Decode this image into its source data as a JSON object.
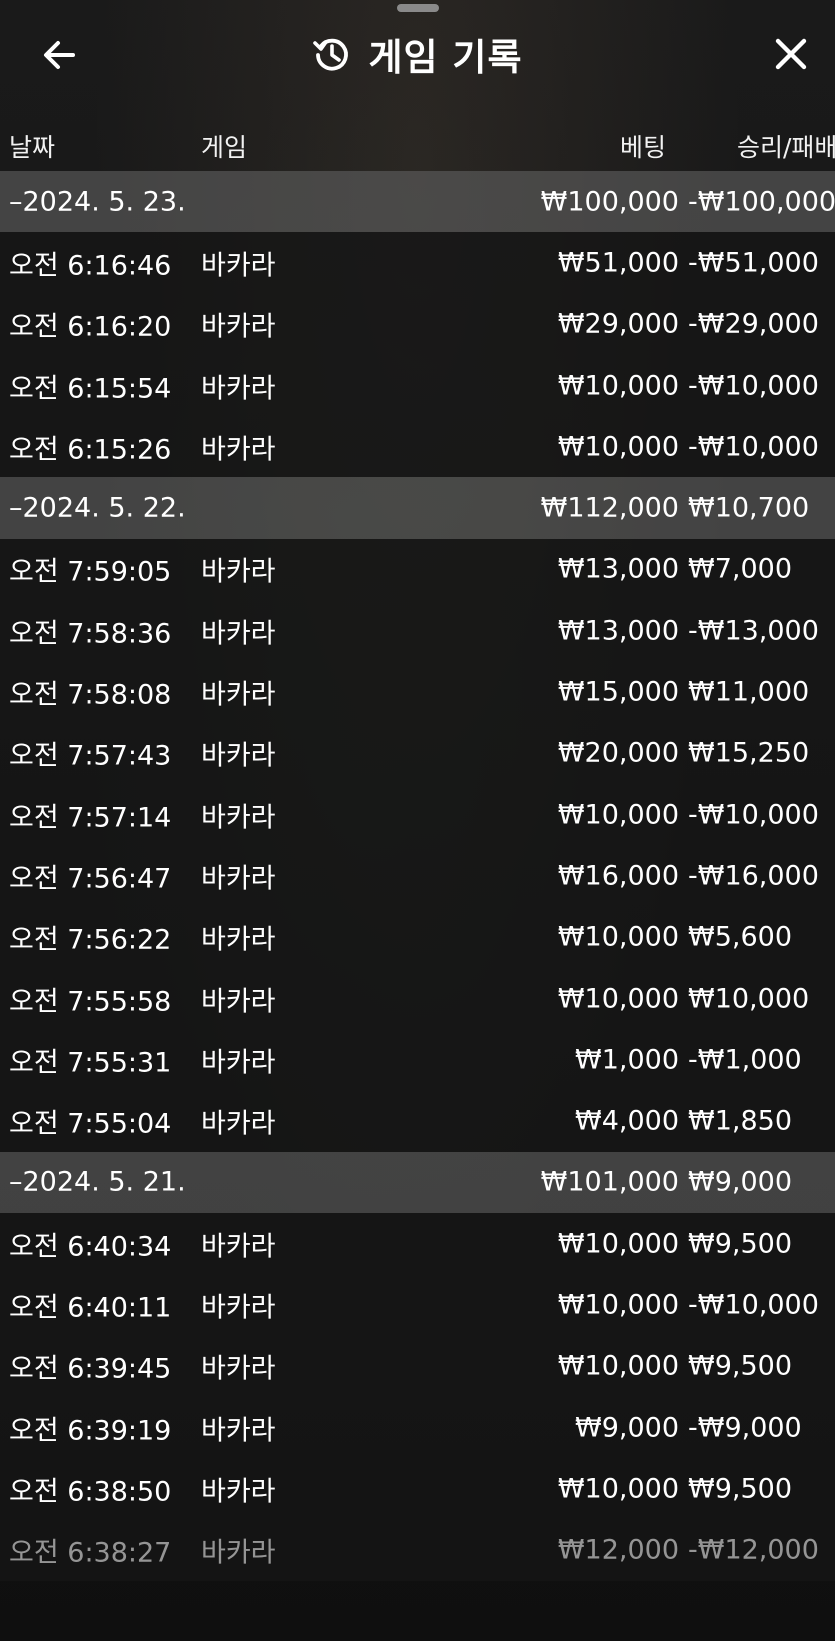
{
  "header": {
    "title": "게임 기록",
    "icons": {
      "back": "arrow-left-icon",
      "history": "history-icon",
      "close": "close-icon"
    }
  },
  "columns": {
    "date": "날짜",
    "game": "게임",
    "bet": "베팅",
    "result": "승리/패배"
  },
  "groups": [
    {
      "date": "–2024. 5. 23.",
      "bet": "₩100,000",
      "result": "-₩100,000",
      "rows": [
        {
          "time": "오전 6:16:46",
          "game": "바카라",
          "bet": "₩51,000",
          "result": "-₩51,000"
        },
        {
          "time": "오전 6:16:20",
          "game": "바카라",
          "bet": "₩29,000",
          "result": "-₩29,000"
        },
        {
          "time": "오전 6:15:54",
          "game": "바카라",
          "bet": "₩10,000",
          "result": "-₩10,000"
        },
        {
          "time": "오전 6:15:26",
          "game": "바카라",
          "bet": "₩10,000",
          "result": "-₩10,000"
        }
      ]
    },
    {
      "date": "–2024. 5. 22.",
      "bet": "₩112,000",
      "result": "₩10,700",
      "rows": [
        {
          "time": "오전 7:59:05",
          "game": "바카라",
          "bet": "₩13,000",
          "result": "₩7,000"
        },
        {
          "time": "오전 7:58:36",
          "game": "바카라",
          "bet": "₩13,000",
          "result": "-₩13,000"
        },
        {
          "time": "오전 7:58:08",
          "game": "바카라",
          "bet": "₩15,000",
          "result": "₩11,000"
        },
        {
          "time": "오전 7:57:43",
          "game": "바카라",
          "bet": "₩20,000",
          "result": "₩15,250"
        },
        {
          "time": "오전 7:57:14",
          "game": "바카라",
          "bet": "₩10,000",
          "result": "-₩10,000"
        },
        {
          "time": "오전 7:56:47",
          "game": "바카라",
          "bet": "₩16,000",
          "result": "-₩16,000"
        },
        {
          "time": "오전 7:56:22",
          "game": "바카라",
          "bet": "₩10,000",
          "result": "₩5,600"
        },
        {
          "time": "오전 7:55:58",
          "game": "바카라",
          "bet": "₩10,000",
          "result": "₩10,000"
        },
        {
          "time": "오전 7:55:31",
          "game": "바카라",
          "bet": "₩1,000",
          "result": "-₩1,000"
        },
        {
          "time": "오전 7:55:04",
          "game": "바카라",
          "bet": "₩4,000",
          "result": "₩1,850"
        }
      ]
    },
    {
      "date": "–2024. 5. 21.",
      "bet": "₩101,000",
      "result": "₩9,000",
      "rows": [
        {
          "time": "오전 6:40:34",
          "game": "바카라",
          "bet": "₩10,000",
          "result": "₩9,500"
        },
        {
          "time": "오전 6:40:11",
          "game": "바카라",
          "bet": "₩10,000",
          "result": "-₩10,000"
        },
        {
          "time": "오전 6:39:45",
          "game": "바카라",
          "bet": "₩10,000",
          "result": "₩9,500"
        },
        {
          "time": "오전 6:39:19",
          "game": "바카라",
          "bet": "₩9,000",
          "result": "-₩9,000"
        },
        {
          "time": "오전 6:38:50",
          "game": "바카라",
          "bet": "₩10,000",
          "result": "₩9,500"
        },
        {
          "time": "오전 6:38:27",
          "game": "바카라",
          "bet": "₩12,000",
          "result": "-₩12,000"
        }
      ]
    }
  ]
}
